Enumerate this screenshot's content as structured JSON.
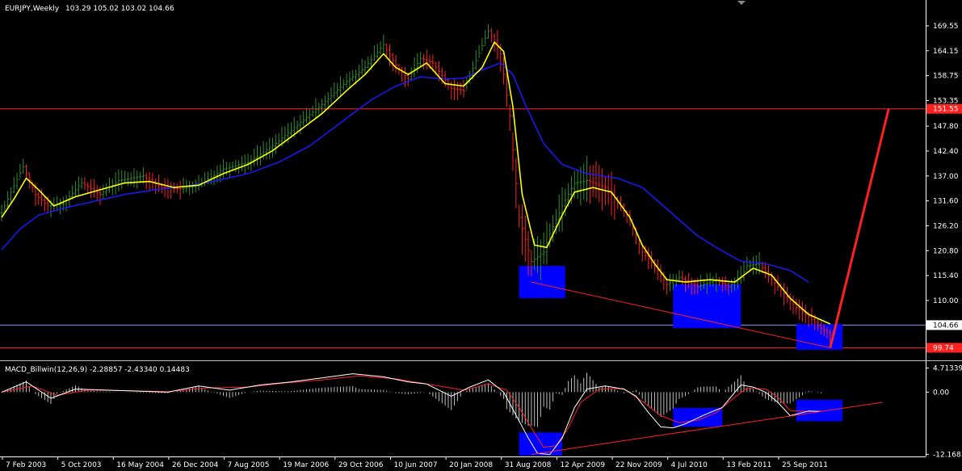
{
  "header": {
    "symbol": "EURJPY,Weekly",
    "ohlc": "103.29 105.02 103.02 104.66",
    "macd_label": "MACD_Billwin(12,26,9) -2.28857 -2.43340 0.14483"
  },
  "colors": {
    "background": "#000000",
    "bull_bar": "#2f8f2f",
    "bear_bar": "#ff2020",
    "ema_fast": "#ffff00",
    "ema_slow": "#1a1aff",
    "hline": "#ff2020",
    "price_line": "#8f8fff",
    "box": "#0000ff",
    "macd_line": "#ffffff",
    "signal_line": "#ff2020",
    "histogram": "#c0c0c0",
    "axis": "#ffffff"
  },
  "chart_data": [
    {
      "type": "candlestick",
      "panel": "price",
      "ylim": [
        97.2,
        173.4
      ],
      "y_ticks": [
        "169.55",
        "164.15",
        "158.75",
        "153.35",
        "147.80",
        "142.40",
        "137.00",
        "131.60",
        "126.20",
        "120.80",
        "115.40",
        "110.00",
        "104.60"
      ],
      "horizontal_levels": [
        {
          "value": 151.55,
          "label": "151.55"
        },
        {
          "value": 99.74,
          "label": "99.74"
        }
      ],
      "current_price": {
        "value": 104.66,
        "label": "104.66"
      },
      "x_labels": [
        "7 Feb 2003",
        "5 Oct 2003",
        "16 May 2004",
        "26 Dec 2004",
        "7 Aug 2005",
        "19 Mar 2006",
        "29 Oct 2006",
        "10 Jun 2007",
        "20 Jan 2008",
        "31 Aug 2008",
        "12 Apr 2009",
        "22 Nov 2009",
        "4 Jul 2010",
        "13 Feb 2011",
        "25 Sep 2011"
      ],
      "price_path": [
        [
          0,
          129.0
        ],
        [
          3,
          133.5
        ],
        [
          7,
          139.0
        ],
        [
          11,
          133.0
        ],
        [
          15,
          130.5
        ],
        [
          20,
          131.0
        ],
        [
          26,
          135.5
        ],
        [
          32,
          133.0
        ],
        [
          38,
          136.0
        ],
        [
          46,
          137.0
        ],
        [
          52,
          134.5
        ],
        [
          58,
          134.2
        ],
        [
          64,
          135.0
        ],
        [
          72,
          138.5
        ],
        [
          80,
          140.0
        ],
        [
          88,
          143.5
        ],
        [
          96,
          148.0
        ],
        [
          104,
          152.5
        ],
        [
          112,
          157.5
        ],
        [
          118,
          160.5
        ],
        [
          124,
          165.5
        ],
        [
          128,
          161.0
        ],
        [
          132,
          158.0
        ],
        [
          136,
          162.5
        ],
        [
          140,
          161.5
        ],
        [
          146,
          156.0
        ],
        [
          150,
          155.5
        ],
        [
          154,
          162.0
        ],
        [
          158,
          168.5
        ],
        [
          162,
          163.5
        ],
        [
          165,
          150.0
        ],
        [
          168,
          128.0
        ],
        [
          172,
          118.5
        ],
        [
          176,
          120.5
        ],
        [
          178,
          124.5
        ],
        [
          182,
          130.5
        ],
        [
          186,
          135.5
        ],
        [
          190,
          136.0
        ],
        [
          196,
          134.5
        ],
        [
          200,
          131.5
        ],
        [
          204,
          127.5
        ],
        [
          208,
          120.5
        ],
        [
          212,
          117.5
        ],
        [
          216,
          113.5
        ],
        [
          220,
          115.0
        ],
        [
          226,
          113.0
        ],
        [
          232,
          114.5
        ],
        [
          236,
          113.0
        ],
        [
          240,
          115.0
        ],
        [
          242,
          117.5
        ],
        [
          246,
          118.0
        ],
        [
          250,
          114.5
        ],
        [
          254,
          111.5
        ],
        [
          258,
          108.5
        ],
        [
          262,
          106.5
        ],
        [
          266,
          104.0
        ],
        [
          269,
          102.5
        ]
      ],
      "ema_fast_path": [
        [
          0,
          128.0
        ],
        [
          4,
          132.0
        ],
        [
          8,
          136.5
        ],
        [
          12,
          134.0
        ],
        [
          17,
          130.5
        ],
        [
          24,
          132.5
        ],
        [
          32,
          134.0
        ],
        [
          40,
          135.5
        ],
        [
          48,
          135.8
        ],
        [
          56,
          134.5
        ],
        [
          64,
          135.0
        ],
        [
          72,
          137.5
        ],
        [
          80,
          139.5
        ],
        [
          88,
          142.5
        ],
        [
          96,
          146.5
        ],
        [
          104,
          150.5
        ],
        [
          112,
          155.5
        ],
        [
          118,
          159.0
        ],
        [
          124,
          163.5
        ],
        [
          128,
          160.5
        ],
        [
          132,
          159.0
        ],
        [
          138,
          161.5
        ],
        [
          144,
          157.0
        ],
        [
          150,
          156.5
        ],
        [
          156,
          160.5
        ],
        [
          160,
          166.0
        ],
        [
          163,
          164.0
        ],
        [
          166,
          152.0
        ],
        [
          169,
          133.0
        ],
        [
          173,
          122.0
        ],
        [
          177,
          121.5
        ],
        [
          182,
          128.5
        ],
        [
          186,
          133.5
        ],
        [
          192,
          134.5
        ],
        [
          198,
          133.5
        ],
        [
          204,
          128.0
        ],
        [
          208,
          122.0
        ],
        [
          212,
          118.0
        ],
        [
          216,
          114.5
        ],
        [
          222,
          114.0
        ],
        [
          230,
          114.5
        ],
        [
          238,
          114.0
        ],
        [
          244,
          117.0
        ],
        [
          250,
          115.5
        ],
        [
          256,
          110.5
        ],
        [
          262,
          107.0
        ],
        [
          266,
          105.8
        ],
        [
          269,
          104.9
        ]
      ],
      "ema_slow_path": [
        [
          0,
          121.0
        ],
        [
          6,
          125.5
        ],
        [
          12,
          128.5
        ],
        [
          20,
          130.0
        ],
        [
          30,
          131.5
        ],
        [
          40,
          133.0
        ],
        [
          50,
          134.0
        ],
        [
          60,
          134.8
        ],
        [
          70,
          136.0
        ],
        [
          80,
          137.5
        ],
        [
          90,
          140.0
        ],
        [
          100,
          143.5
        ],
        [
          110,
          148.5
        ],
        [
          120,
          153.5
        ],
        [
          128,
          156.5
        ],
        [
          136,
          158.5
        ],
        [
          144,
          158.0
        ],
        [
          150,
          158.2
        ],
        [
          156,
          160.0
        ],
        [
          162,
          161.5
        ],
        [
          166,
          159.0
        ],
        [
          170,
          152.5
        ],
        [
          176,
          144.0
        ],
        [
          182,
          139.5
        ],
        [
          190,
          137.5
        ],
        [
          200,
          136.5
        ],
        [
          208,
          134.5
        ],
        [
          214,
          131.0
        ],
        [
          220,
          127.5
        ],
        [
          226,
          124.0
        ],
        [
          232,
          121.5
        ],
        [
          240,
          118.5
        ],
        [
          248,
          118.0
        ],
        [
          256,
          116.5
        ],
        [
          262,
          114.0
        ]
      ],
      "support_line": [
        [
          172,
          114.0
        ],
        [
          269,
          99.74
        ]
      ],
      "projection": [
        [
          269,
          99.74
        ],
        [
          288,
          151.55
        ]
      ],
      "highlight_boxes": [
        {
          "x0": 168,
          "x1": 183,
          "y0": 110.5,
          "y1": 117.5
        },
        {
          "x0": 218,
          "x1": 240,
          "y0": 104.0,
          "y1": 113.5
        },
        {
          "x0": 258,
          "x1": 273,
          "y0": 99.3,
          "y1": 104.9
        }
      ]
    },
    {
      "type": "macd",
      "panel": "indicator",
      "ylim": [
        -12.6,
        5.6
      ],
      "y_ticks": [
        "4.71339",
        "0.00",
        "-12.1683"
      ],
      "macd_path": [
        [
          0,
          0.0
        ],
        [
          8,
          2.0
        ],
        [
          16,
          -1.2
        ],
        [
          24,
          0.6
        ],
        [
          34,
          0.4
        ],
        [
          44,
          0.2
        ],
        [
          54,
          0.0
        ],
        [
          64,
          1.2
        ],
        [
          74,
          0.4
        ],
        [
          84,
          1.4
        ],
        [
          94,
          2.0
        ],
        [
          104,
          2.8
        ],
        [
          114,
          3.6
        ],
        [
          124,
          3.0
        ],
        [
          132,
          2.0
        ],
        [
          138,
          1.6
        ],
        [
          146,
          -0.8
        ],
        [
          152,
          1.0
        ],
        [
          158,
          2.4
        ],
        [
          163,
          0.0
        ],
        [
          167,
          -4.5
        ],
        [
          171,
          -9.0
        ],
        [
          174,
          -12.0
        ],
        [
          178,
          -12.2
        ],
        [
          182,
          -9.0
        ],
        [
          186,
          -3.0
        ],
        [
          190,
          0.6
        ],
        [
          196,
          1.2
        ],
        [
          202,
          0.6
        ],
        [
          206,
          -0.8
        ],
        [
          210,
          -4.0
        ],
        [
          214,
          -6.8
        ],
        [
          218,
          -7.0
        ],
        [
          222,
          -6.2
        ],
        [
          228,
          -4.5
        ],
        [
          234,
          -3.0
        ],
        [
          240,
          1.4
        ],
        [
          244,
          1.0
        ],
        [
          248,
          0.0
        ],
        [
          252,
          -2.0
        ],
        [
          256,
          -4.6
        ],
        [
          262,
          -3.7
        ],
        [
          266,
          -3.8
        ]
      ],
      "signal_path": [
        [
          0,
          0.0
        ],
        [
          10,
          1.2
        ],
        [
          18,
          -0.6
        ],
        [
          28,
          0.4
        ],
        [
          40,
          0.3
        ],
        [
          54,
          0.1
        ],
        [
          66,
          0.8
        ],
        [
          80,
          1.0
        ],
        [
          92,
          1.8
        ],
        [
          104,
          2.4
        ],
        [
          116,
          3.2
        ],
        [
          128,
          2.6
        ],
        [
          140,
          1.4
        ],
        [
          150,
          0.4
        ],
        [
          158,
          1.6
        ],
        [
          164,
          0.4
        ],
        [
          168,
          -3.0
        ],
        [
          172,
          -7.0
        ],
        [
          176,
          -10.8
        ],
        [
          180,
          -10.5
        ],
        [
          184,
          -7.0
        ],
        [
          188,
          -2.0
        ],
        [
          194,
          0.6
        ],
        [
          202,
          0.7
        ],
        [
          208,
          -1.8
        ],
        [
          214,
          -4.6
        ],
        [
          220,
          -6.0
        ],
        [
          226,
          -5.5
        ],
        [
          232,
          -4.0
        ],
        [
          238,
          -1.0
        ],
        [
          242,
          0.8
        ],
        [
          248,
          0.6
        ],
        [
          252,
          -1.0
        ],
        [
          256,
          -3.6
        ],
        [
          262,
          -3.8
        ],
        [
          266,
          -3.7
        ]
      ],
      "macd_trendline": [
        [
          172,
          -12.2
        ],
        [
          286,
          -2.0
        ]
      ],
      "highlight_boxes": [
        {
          "x0": 168,
          "x1": 182,
          "y0": -12.4,
          "y1": -7.9
        },
        {
          "x0": 218,
          "x1": 234,
          "y0": -6.8,
          "y1": -3.1
        },
        {
          "x0": 258,
          "x1": 273,
          "y0": -5.7,
          "y1": -1.5
        }
      ]
    }
  ]
}
